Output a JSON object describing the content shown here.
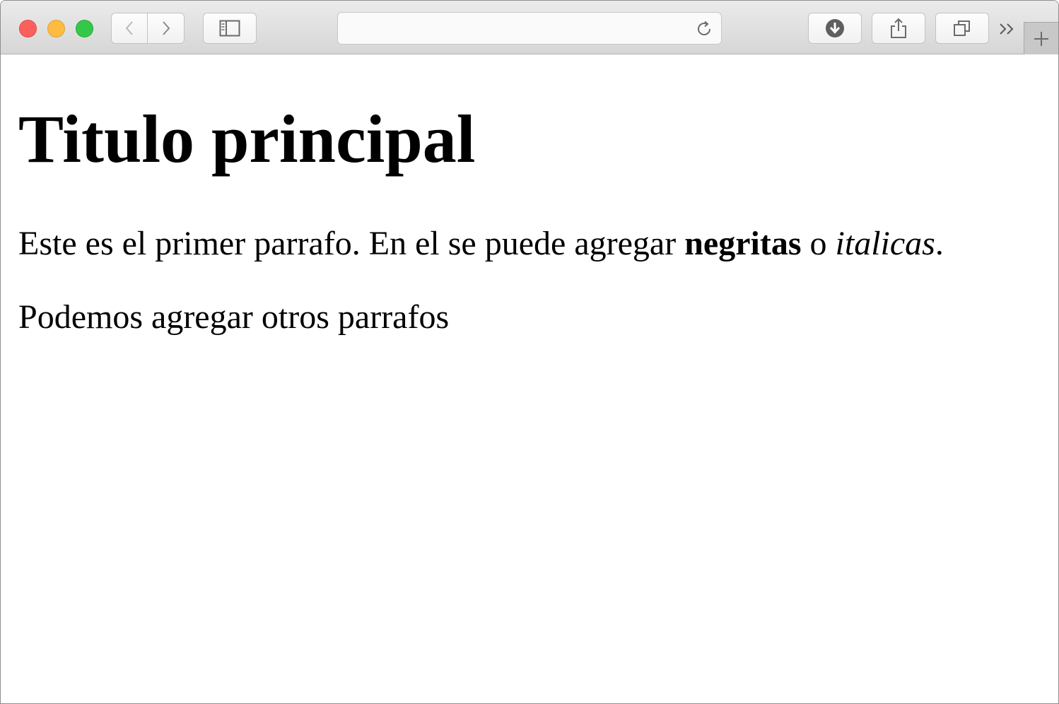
{
  "browser": {
    "address_text": "",
    "icons": {
      "back": "chevron-left-icon",
      "forward": "chevron-right-icon",
      "sidebar": "sidebar-icon",
      "reload": "reload-icon",
      "downloads": "download-icon",
      "share": "share-icon",
      "tabs": "tab-overview-icon",
      "overflow": "double-chevron-right-icon",
      "new_tab": "plus-icon"
    },
    "colors": {
      "close": "#fc605c",
      "minimize": "#fdbc40",
      "maximize": "#34c84a"
    }
  },
  "page": {
    "heading": "Titulo principal",
    "paragraph1": {
      "text_start": "Este es el primer parrafo. En el se puede agregar ",
      "bold": "negritas",
      "middle": " o ",
      "italic": "italicas",
      "end": "."
    },
    "paragraph2": "Podemos agregar otros parrafos"
  }
}
